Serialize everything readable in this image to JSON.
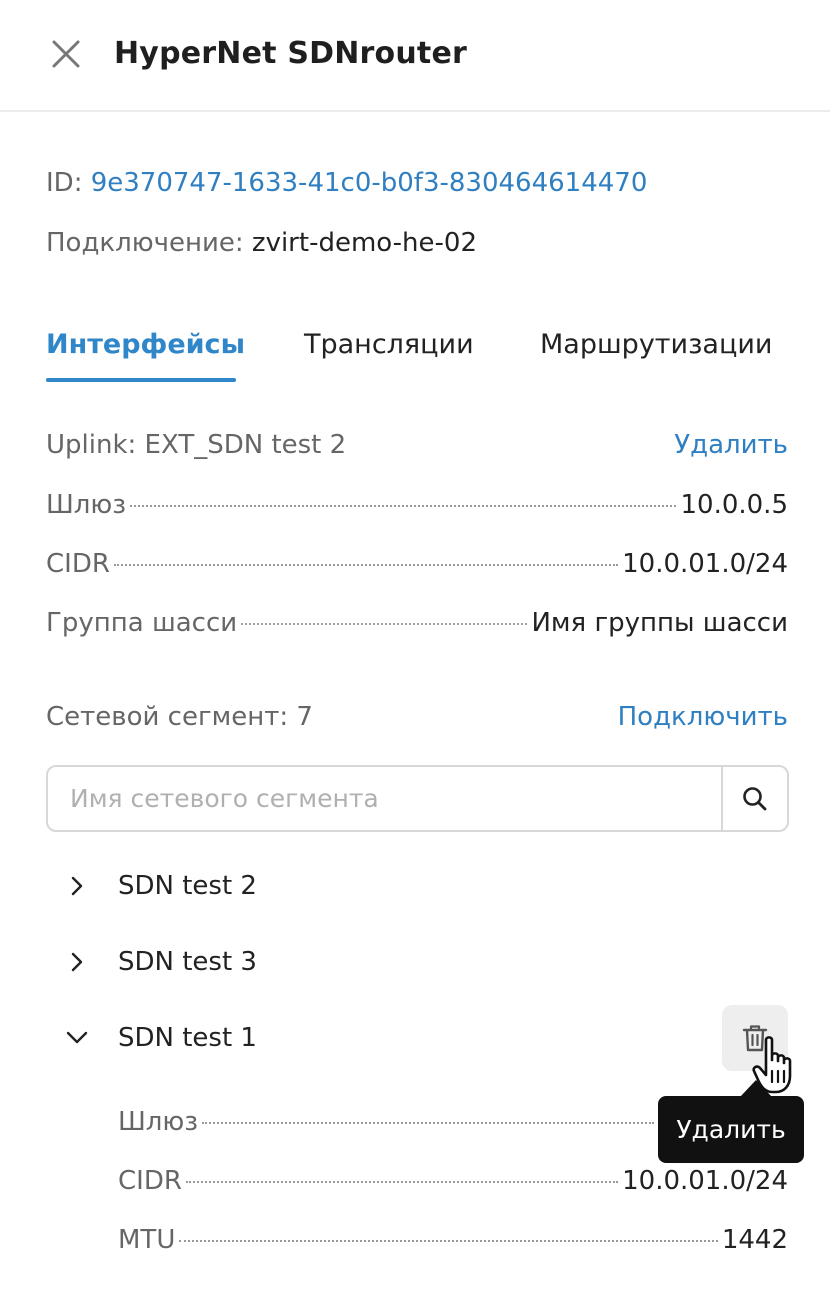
{
  "header": {
    "title": "HyperNet SDNrouter",
    "close_icon": "close-icon"
  },
  "meta": {
    "id_label": "ID:",
    "id_value": "9e370747-1633-41c0-b0f3-830464614470",
    "connection_label": "Подключение:",
    "connection_value": "zvirt-demo-he-02"
  },
  "tabs": [
    {
      "label": "Интерфейсы",
      "active": true
    },
    {
      "label": "Трансляции",
      "active": false
    },
    {
      "label": "Маршрутизации",
      "active": false
    }
  ],
  "uplink": {
    "label": "Uplink: EXT_SDN test 2",
    "action": "Удалить",
    "rows": [
      {
        "label": "Шлюз",
        "value": "10.0.0.5"
      },
      {
        "label": "CIDR",
        "value": "10.0.01.0/24"
      },
      {
        "label": "Группа шасси",
        "value": "Имя группы шасси"
      }
    ]
  },
  "segments": {
    "label": "Сетевой сегмент: 7",
    "action": "Подключить",
    "search_placeholder": "Имя сетевого сегмента",
    "items": [
      {
        "label": "SDN test 2",
        "expanded": false
      },
      {
        "label": "SDN test 3",
        "expanded": false
      },
      {
        "label": "SDN test 1",
        "expanded": true
      }
    ],
    "expanded_rows": [
      {
        "label": "Шлюз",
        "value": ""
      },
      {
        "label": "CIDR",
        "value": "10.0.01.0/24"
      },
      {
        "label": "MTU",
        "value": "1442"
      }
    ]
  },
  "tooltip": {
    "text": "Удалить"
  },
  "colors": {
    "accent": "#2f86c8",
    "link": "#2f7fc1",
    "tooltip_bg": "#111111"
  }
}
